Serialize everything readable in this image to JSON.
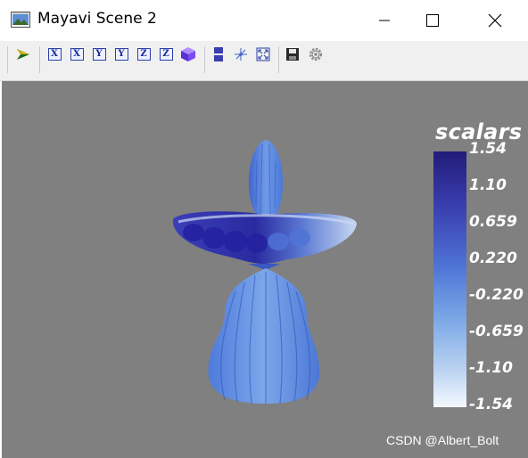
{
  "window": {
    "title": "Mayavi Scene 2"
  },
  "toolbar": {
    "buttons": [
      {
        "name": "mayavi-logo",
        "icon": "mayavi-logo-icon"
      },
      {
        "name": "view-x-minus",
        "label": "X"
      },
      {
        "name": "view-x-plus",
        "label": "X"
      },
      {
        "name": "view-y-minus",
        "label": "Y"
      },
      {
        "name": "view-y-plus",
        "label": "Y"
      },
      {
        "name": "view-z-minus",
        "label": "Z"
      },
      {
        "name": "view-z-plus",
        "label": "Z"
      },
      {
        "name": "isometric",
        "icon": "cube-icon"
      },
      {
        "name": "parallel-projection",
        "icon": "projection-icon"
      },
      {
        "name": "axes",
        "icon": "axes-icon"
      },
      {
        "name": "fullscreen",
        "icon": "fullscreen-icon"
      },
      {
        "name": "save",
        "icon": "save-icon"
      },
      {
        "name": "configure",
        "icon": "gear-icon"
      }
    ]
  },
  "scene": {
    "background": "#808080",
    "colorbar": {
      "title": "scalars",
      "labels": [
        "1.54",
        "1.10",
        "0.659",
        "0.220",
        "-0.220",
        "-0.659",
        "-1.10",
        "-1.54"
      ],
      "colors": [
        "#221c7a",
        "#4f74d6",
        "#f4f8fe"
      ]
    },
    "watermark": "CSDN @Albert_Bolt"
  }
}
